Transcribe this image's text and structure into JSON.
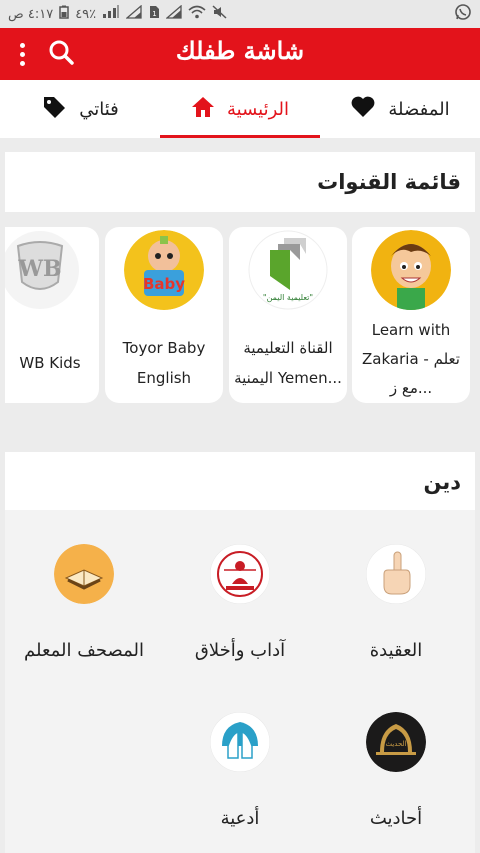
{
  "status_bar": {
    "time": "٤:١٧ ص",
    "battery": "٤٩٪"
  },
  "app_bar": {
    "title": "شاشة طفلك"
  },
  "tabs": [
    {
      "label": "فئاتي",
      "icon": "tag-icon"
    },
    {
      "label": "الرئيسية",
      "icon": "home-icon"
    },
    {
      "label": "المفضلة",
      "icon": "heart-icon"
    }
  ],
  "channels": {
    "title": "قائمة القنوات",
    "items": [
      {
        "name": "Learn with Zakaria - تعلم مع ز...",
        "line1": "Learn with",
        "line2": "Zakaria - تعلم",
        "line3": "مع ز..."
      },
      {
        "name": "القناة التعليمية اليمنية Yemen...",
        "line1": "القناة التعليمية",
        "line2": "اليمنية Yemen..."
      },
      {
        "name": "Toyor Baby English",
        "line1": "Toyor Baby",
        "line2": "English"
      },
      {
        "name": "WB Kids",
        "line1": "WB Kids"
      }
    ]
  },
  "categories": {
    "title": "دين",
    "items": [
      {
        "label": "العقيدة",
        "icon": "raised-finger-icon"
      },
      {
        "label": "آداب وأخلاق",
        "icon": "scales-book-icon"
      },
      {
        "label": "المصحف المعلم",
        "icon": "quran-icon"
      },
      {
        "label": "أحاديث",
        "icon": "mosque-dome-icon"
      },
      {
        "label": "أدعية",
        "icon": "praying-hands-icon"
      }
    ]
  },
  "colors": {
    "accent": "#e3131b",
    "background": "#ececec"
  }
}
